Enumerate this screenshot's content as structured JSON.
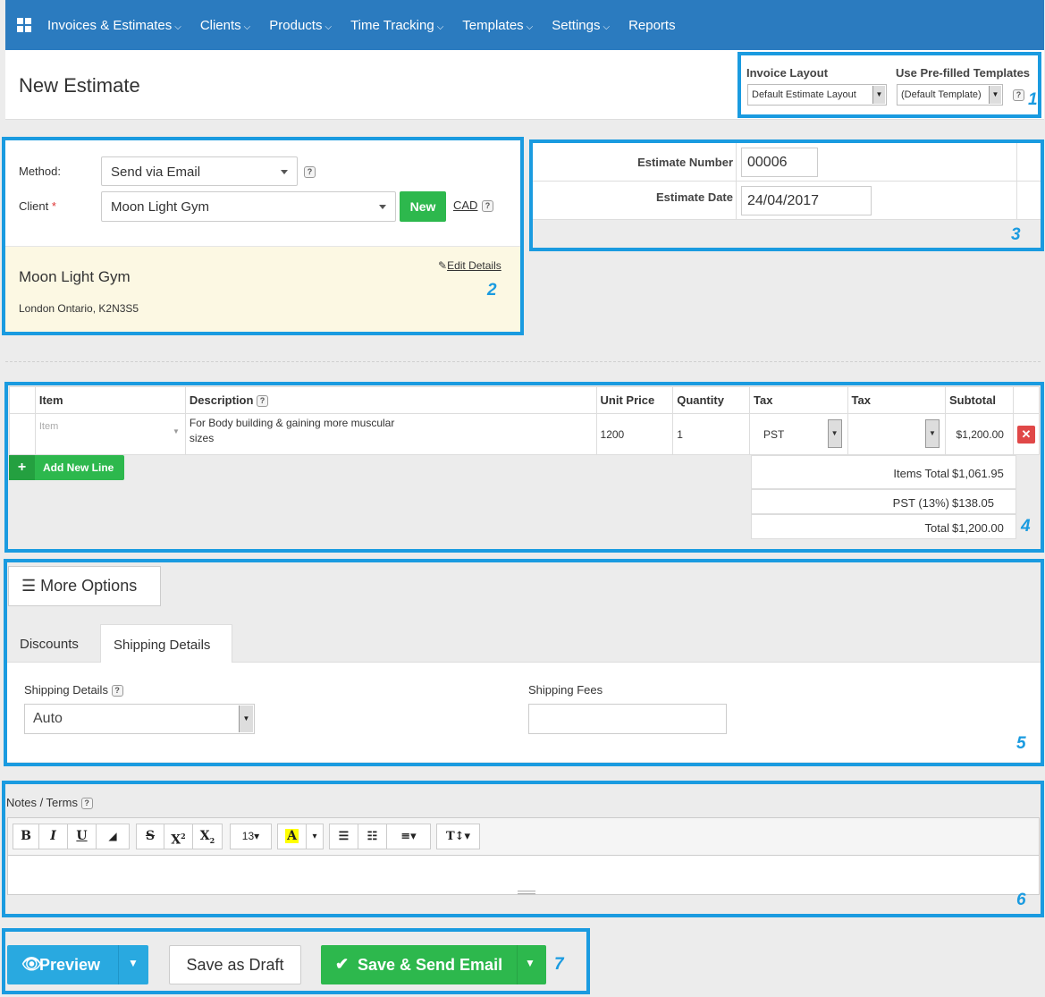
{
  "nav": {
    "items": [
      {
        "label": "Invoices & Estimates",
        "has_dropdown": true
      },
      {
        "label": "Clients",
        "has_dropdown": true
      },
      {
        "label": "Products",
        "has_dropdown": true
      },
      {
        "label": "Time Tracking",
        "has_dropdown": true
      },
      {
        "label": "Templates",
        "has_dropdown": true
      },
      {
        "label": "Settings",
        "has_dropdown": true
      },
      {
        "label": "Reports",
        "has_dropdown": false
      }
    ]
  },
  "header": {
    "title": "New Estimate",
    "invoice_layout_label": "Invoice Layout",
    "invoice_layout_value": "Default Estimate Layout",
    "templates_label": "Use Pre-filled Templates",
    "templates_value": "(Default Template)",
    "help": "?"
  },
  "annotations": [
    "1",
    "2",
    "3",
    "4",
    "5",
    "6",
    "7"
  ],
  "client_section": {
    "method_label": "Method:",
    "method_value": "Send via Email",
    "client_label": "Client",
    "required_mark": "*",
    "client_value": "Moon Light Gym",
    "new_button": "New",
    "currency": "CAD",
    "help": "?",
    "card": {
      "edit_link": "Edit Details",
      "name": "Moon Light Gym",
      "address": "London Ontario, K2N3S5"
    }
  },
  "estimate": {
    "number_label": "Estimate Number",
    "number_value": "00006",
    "date_label": "Estimate Date",
    "date_value": "24/04/2017"
  },
  "items": {
    "headers": [
      "Item",
      "Description",
      "Unit Price",
      "Quantity",
      "Tax",
      "Tax",
      "Subtotal"
    ],
    "description_help": "?",
    "rows": [
      {
        "item_placeholder": "Item",
        "description": "For Body building & gaining more  muscular sizes",
        "unit_price": "1200",
        "quantity": "1",
        "tax1": "PST",
        "tax2": "",
        "subtotal": "$1,200.00"
      }
    ],
    "add_line": "Add New Line",
    "totals": [
      {
        "label": "Items Total",
        "value": "$1,061.95"
      },
      {
        "label": "PST (13%)",
        "value": "$138.05"
      },
      {
        "label": "Total",
        "value": "$1,200.00"
      }
    ]
  },
  "options": {
    "more_options": "More Options",
    "tabs": [
      "Discounts",
      "Shipping Details"
    ],
    "active_tab": "Shipping Details",
    "shipping_details_label": "Shipping Details",
    "shipping_details_value": "Auto",
    "shipping_fees_label": "Shipping Fees",
    "shipping_fees_value": "",
    "help": "?"
  },
  "notes": {
    "label": "Notes / Terms",
    "help": "?",
    "font_size": "13"
  },
  "footer": {
    "preview": "Preview",
    "save_draft": "Save as Draft",
    "save_send": "Save & Send Email"
  },
  "colors": {
    "nav": "#2b7bbf",
    "highlight": "#1a9be0",
    "green": "#2db84d",
    "preview_blue": "#29a9e0",
    "delete_red": "#e04848",
    "client_card": "#fcf8e3"
  }
}
